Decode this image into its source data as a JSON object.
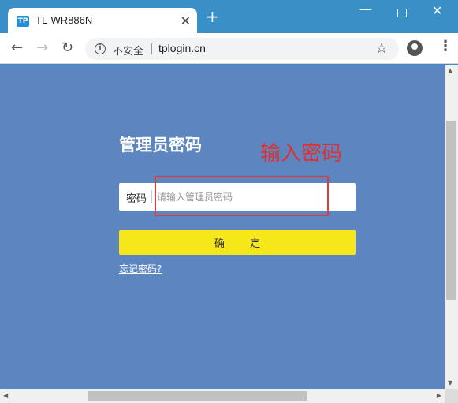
{
  "browser": {
    "tab": {
      "favicon_text": "TP",
      "title": "TL-WR886N",
      "close_glyph": "✕"
    },
    "new_tab_glyph": "+",
    "window_controls": {
      "minimize": "—",
      "close": "✕"
    },
    "toolbar": {
      "back_glyph": "←",
      "forward_glyph": "→",
      "reload_glyph": "↻",
      "security_label": "不安全",
      "url": "tplogin.cn",
      "star_glyph": "☆",
      "menu_glyph": "⋮"
    }
  },
  "page": {
    "background_color": "#5d86c1",
    "title": "管理员密码",
    "annotation": "输入密码",
    "annotation_color": "#e03030",
    "password_field": {
      "label": "密码",
      "placeholder": "请输入管理员密码",
      "value": ""
    },
    "confirm_button": {
      "label": "确 定",
      "color": "#f5e719"
    },
    "forgot_link": "忘记密码?"
  }
}
